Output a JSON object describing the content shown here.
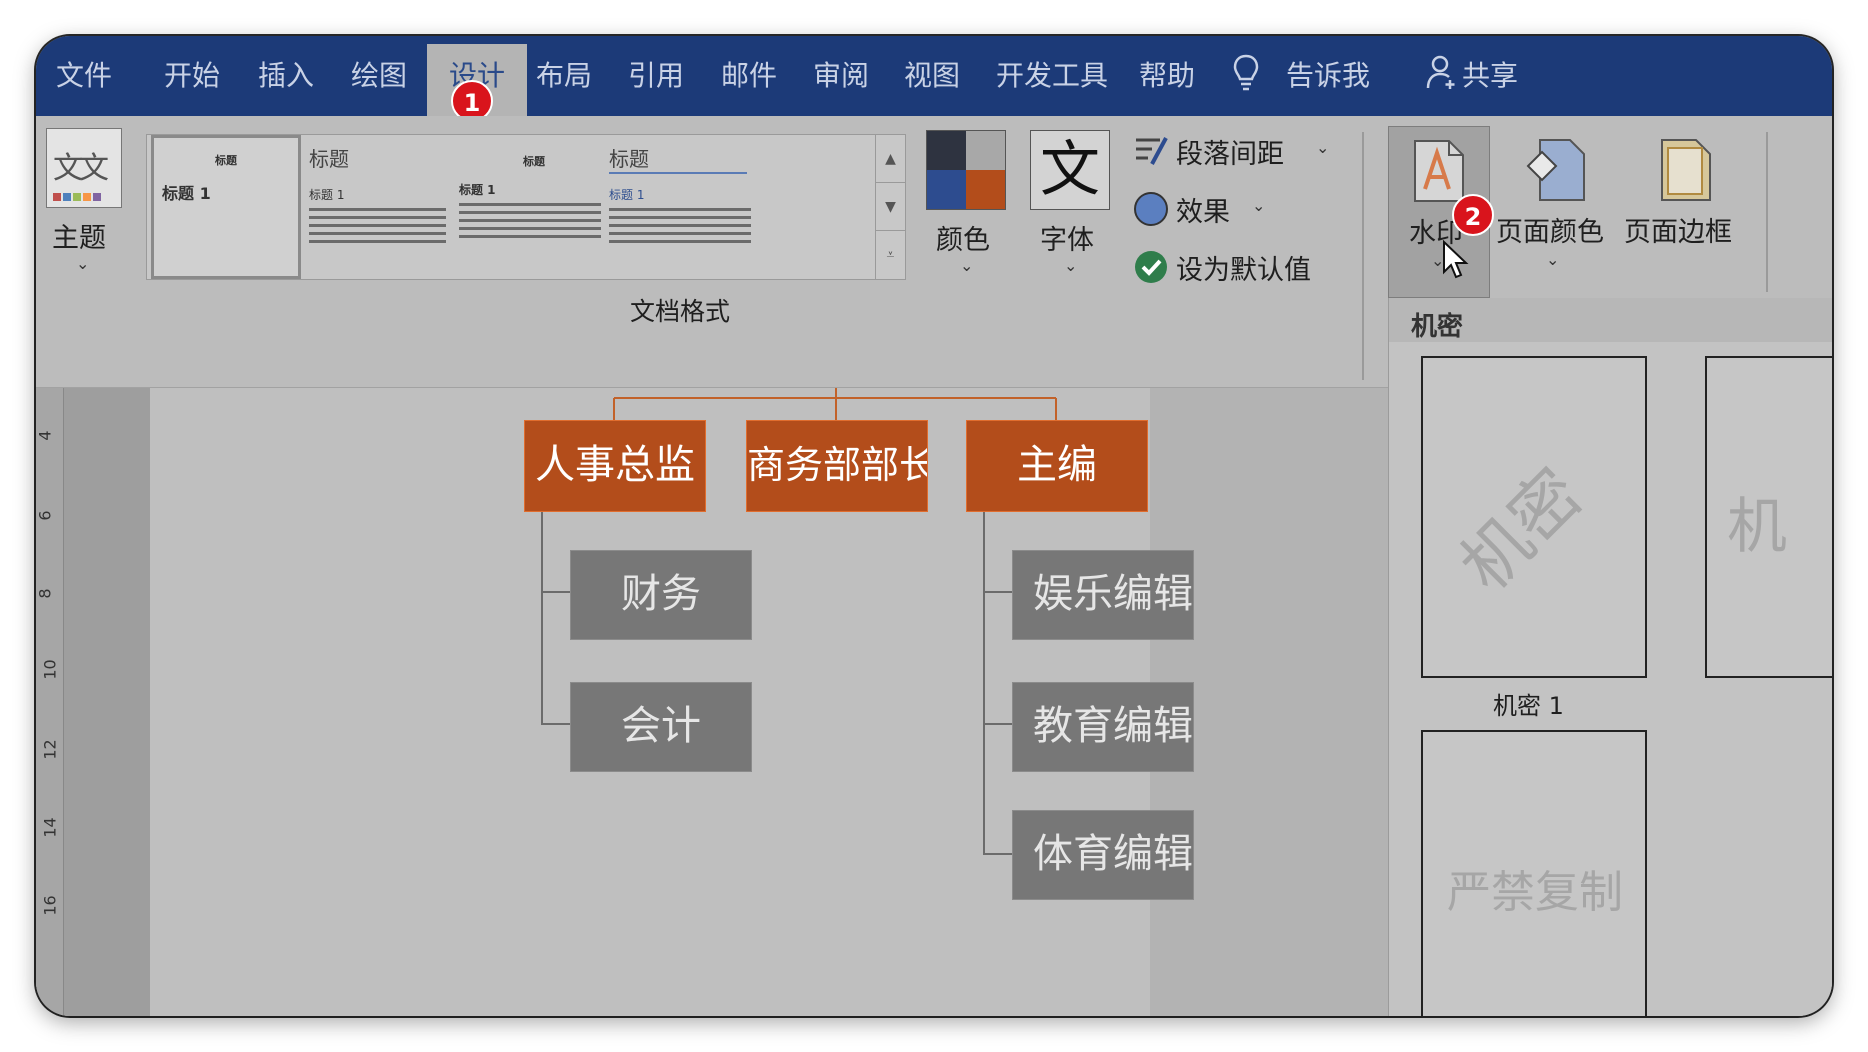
{
  "menubar": {
    "tabs": [
      "文件",
      "开始",
      "插入",
      "绘图",
      "设计",
      "布局",
      "引用",
      "邮件",
      "审阅",
      "视图",
      "开发工具",
      "帮助"
    ],
    "active_tab": "设计",
    "tell_me": "告诉我",
    "share": "共享"
  },
  "badges": {
    "step1": "1",
    "step2": "2"
  },
  "ribbon": {
    "theme_label": "主题",
    "theme_icon_text": "文文",
    "gallery": {
      "item1": {
        "title": "标题",
        "subtitle": "标题 1"
      },
      "item2": {
        "title": "标题",
        "subtitle": "标题 1"
      },
      "item3": {
        "title": "标题",
        "subtitle": "标题 1"
      },
      "item4": {
        "title": "标题",
        "subtitle": "标题 1"
      }
    },
    "group_label": "文档格式",
    "colors_label": "颜色",
    "fonts_label": "字体",
    "fonts_icon_text": "文",
    "paragraph_spacing": "段落间距",
    "effects": "效果",
    "set_default": "设为默认值",
    "watermark_label": "水印",
    "page_color_label": "页面颜色",
    "page_border_label": "页面边框"
  },
  "ruler": {
    "numbers": [
      "4",
      "6",
      "8",
      "10",
      "12",
      "14",
      "16"
    ]
  },
  "org_chart": {
    "top": [
      "人事总监",
      "商务部部长",
      "主编"
    ],
    "left_children": [
      "财务",
      "会计"
    ],
    "right_children": [
      "娱乐编辑",
      "教育编辑",
      "体育编辑"
    ]
  },
  "watermark_panel": {
    "header": "机密",
    "item1_text": "机密",
    "item1_caption": "机密 1",
    "item2_text": "机",
    "item3_text": "严禁复制"
  },
  "colors": {
    "menubar_bg": "#1c3a78",
    "accent_orange": "#b34d1b",
    "badge_red": "#d9141c",
    "sub_box_gray": "#777777"
  }
}
